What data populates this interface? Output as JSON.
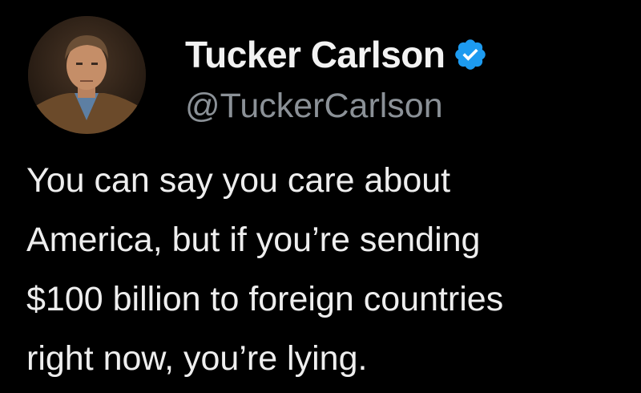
{
  "author": {
    "display_name": "Tucker Carlson",
    "handle": "@TuckerCarlson",
    "verified": true,
    "verified_icon": "verified-badge-icon"
  },
  "tweet": {
    "lines": [
      "You can say you care about",
      "America, but if you’re sending",
      "$100 billion to foreign countries",
      "right now, you’re lying."
    ]
  },
  "colors": {
    "background": "#000000",
    "name": "#f2f2f2",
    "handle": "#8b9197",
    "body": "#eeeeee",
    "verified_blue": "#1d9bf0"
  }
}
